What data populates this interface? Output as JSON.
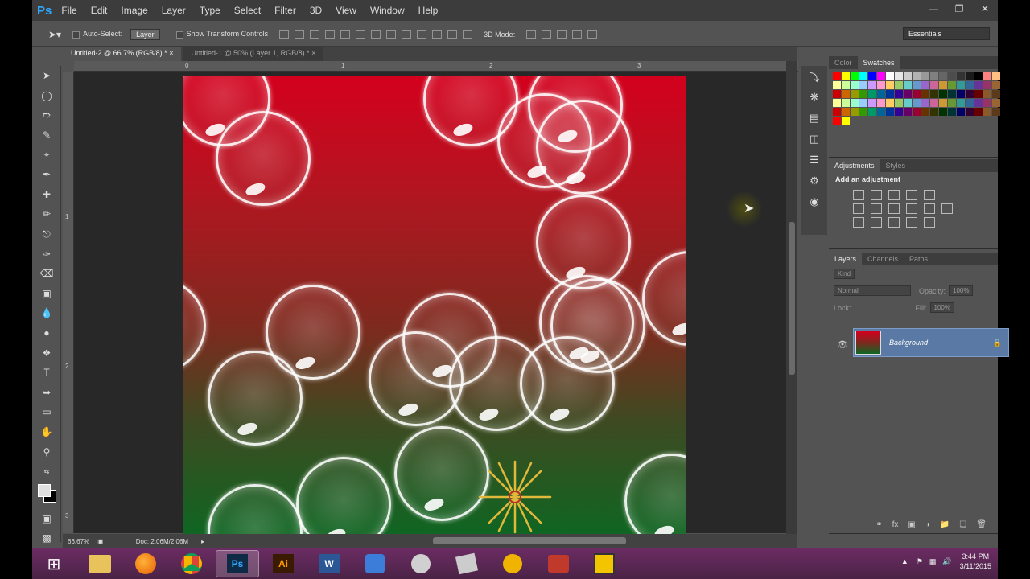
{
  "app": {
    "logo": "Ps"
  },
  "menu": [
    "File",
    "Edit",
    "Image",
    "Layer",
    "Type",
    "Select",
    "Filter",
    "3D",
    "View",
    "Window",
    "Help"
  ],
  "options": {
    "auto_select_label": "Auto-Select:",
    "auto_select_value": "Layer",
    "show_transform_label": "Show Transform Controls",
    "mode_3d_label": "3D Mode:",
    "workspace": "Essentials"
  },
  "tabs": [
    {
      "label": "Untitled-2 @ 66.7% (RGB/8) *",
      "active": true
    },
    {
      "label": "Untitled-1 @ 50% (Layer 1, RGB/8) *",
      "active": false
    }
  ],
  "rulers": {
    "top": [
      "0",
      "1",
      "2",
      "3"
    ],
    "left": [
      "1",
      "2",
      "3"
    ]
  },
  "status": {
    "zoom": "66.67%",
    "doc": "Doc: 2.06M/2.06M"
  },
  "panels": {
    "color_tabs": [
      "Color",
      "Swatches"
    ],
    "adjust_tabs": [
      "Adjustments",
      "Styles"
    ],
    "adjust_title": "Add an adjustment",
    "layers_tabs": [
      "Layers",
      "Channels",
      "Paths"
    ],
    "kind_label": "Kind",
    "blend_mode": "Normal",
    "opacity_label": "Opacity:",
    "opacity_value": "100%",
    "lock_label": "Lock:",
    "fill_label": "Fill:",
    "fill_value": "100%",
    "layer_name": "Background"
  },
  "taskbar": {
    "time": "3:44 PM",
    "date": "3/11/2015"
  },
  "swatch_colors": [
    "#ff0000",
    "#ffff00",
    "#00ff00",
    "#00ffff",
    "#0000ff",
    "#ff00ff",
    "#ffffff",
    "#e6e6e6",
    "#cccccc",
    "#b3b3b3",
    "#999999",
    "#808080",
    "#666666",
    "#4d4d4d",
    "#333333",
    "#1a1a1a",
    "#000000",
    "#ff8080",
    "#ffbf80"
  ]
}
